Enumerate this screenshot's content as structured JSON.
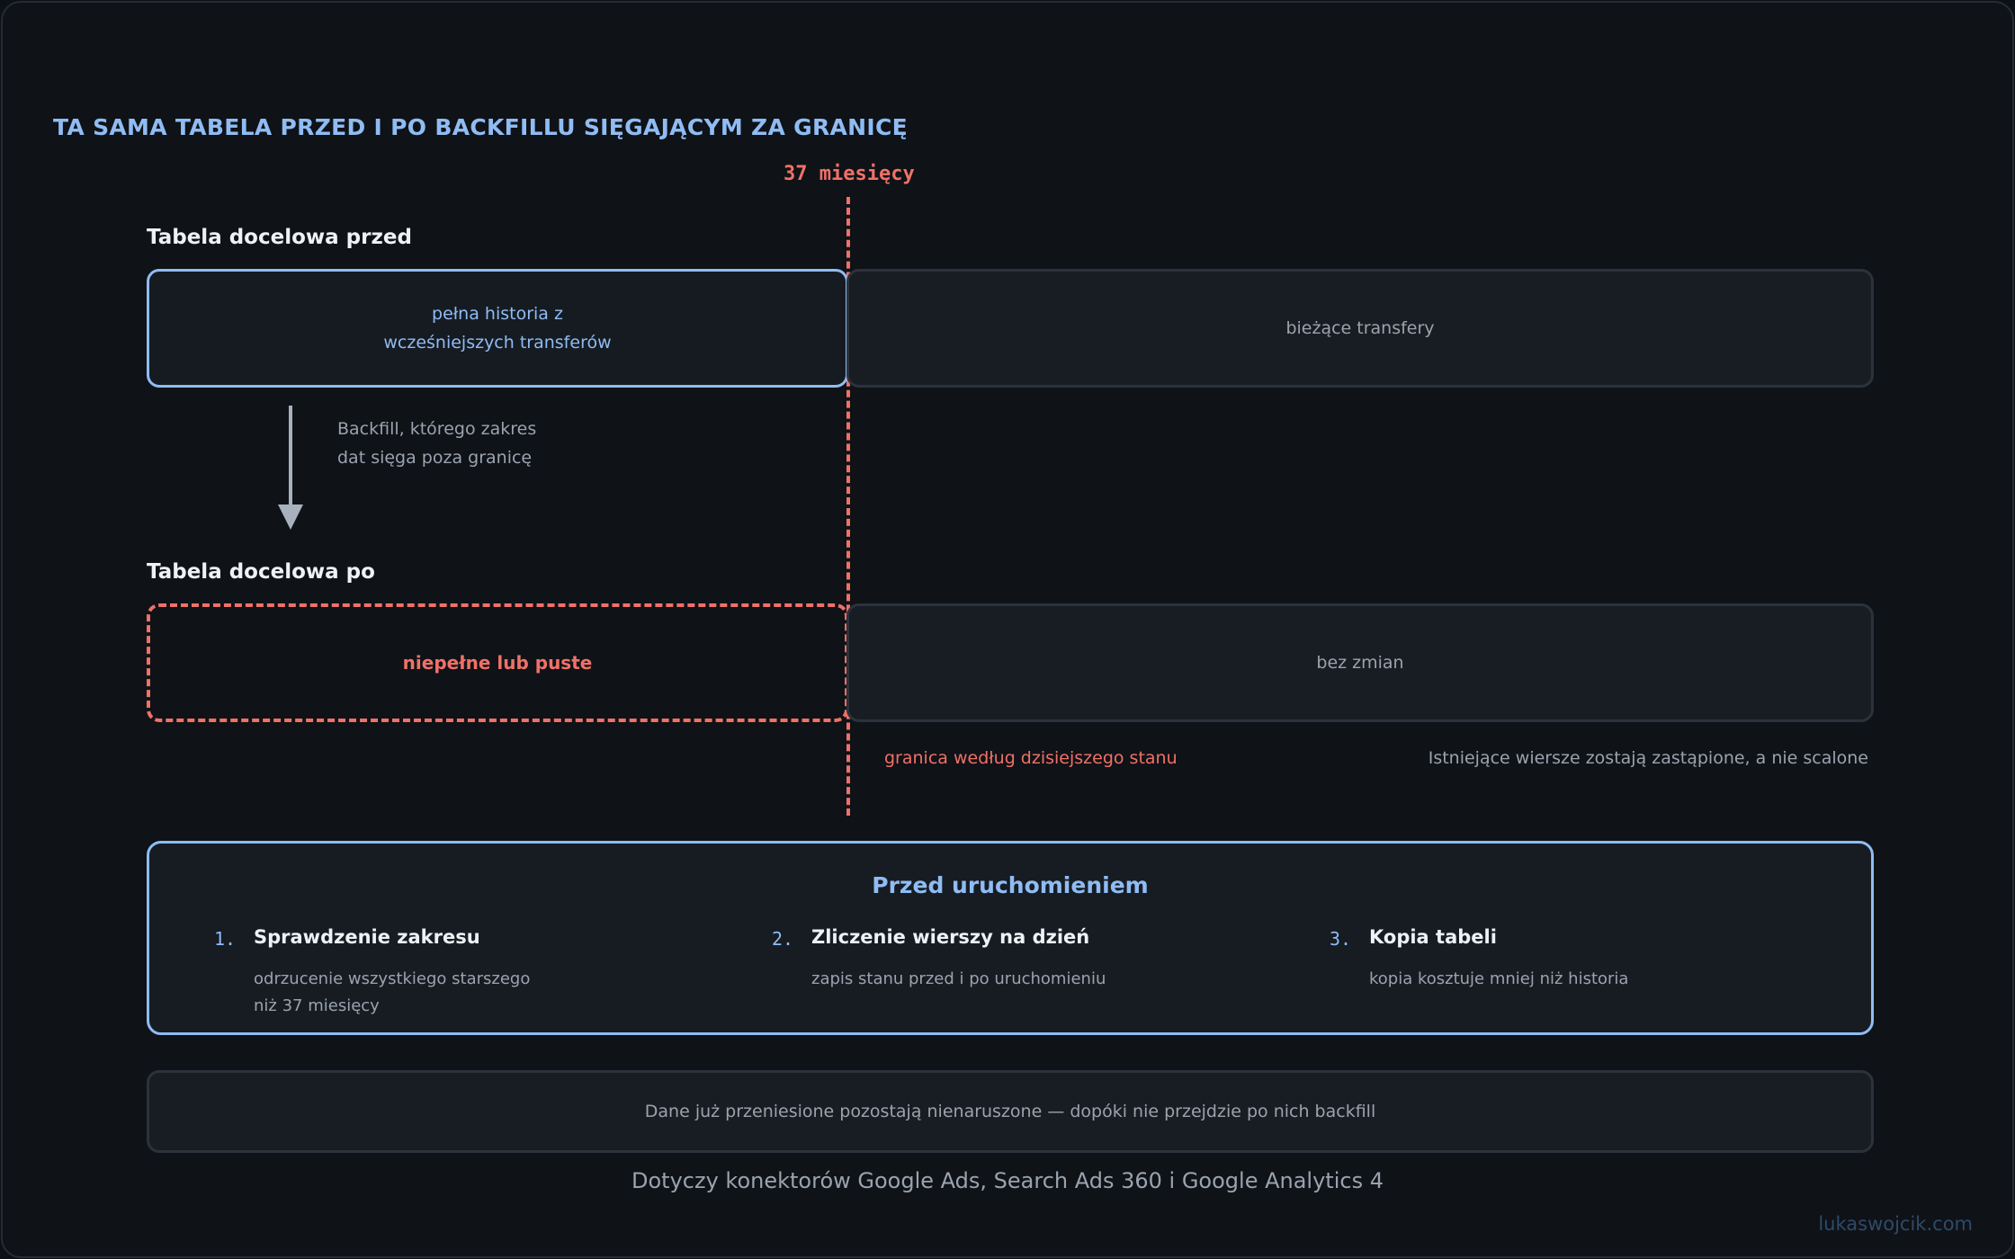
{
  "heading": "TA SAMA TABELA PRZED I PO BACKFILLU SIĘGAJĄCYM ZA GRANICĘ",
  "boundary_label": "37 miesięcy",
  "before": {
    "title": "Tabela docelowa przed",
    "history_box": "pełna historia z wcześniejszych transferów",
    "current_box": "bieżące transfery"
  },
  "arrow_note": "Backfill, którego zakres dat sięga poza granicę",
  "after": {
    "title": "Tabela docelowa po",
    "empty_box": "niepełne lub puste",
    "unchanged_box": "bez zmian"
  },
  "boundary_note": "granica według dzisiejszego stanu",
  "replace_note": "Istniejące wiersze zostają zastąpione, a nie scalone",
  "checklist": {
    "title": "Przed uruchomieniem",
    "steps": [
      {
        "num": "1.",
        "title": "Sprawdzenie zakresu",
        "desc": "odrzucenie wszystkiego starszego niż 37 miesięcy"
      },
      {
        "num": "2.",
        "title": "Zliczenie wierszy na dzień",
        "desc": "zapis stanu przed i po uruchomieniu"
      },
      {
        "num": "3.",
        "title": "Kopia tabeli",
        "desc": "kopia kosztuje mniej niż historia"
      }
    ]
  },
  "footer_box": "Dane już przeniesione pozostają nienaruszone — dopóki nie przejdzie po nich backfill",
  "caption": "Dotyczy konektorów Google Ads, Search Ads 360 i Google Analytics 4",
  "watermark": "lukaswojcik.com",
  "colors": {
    "accent_blue": "#8fbcf3",
    "accent_red": "#f07167",
    "background": "#0f1217",
    "muted_text": "#9aa3ae"
  }
}
